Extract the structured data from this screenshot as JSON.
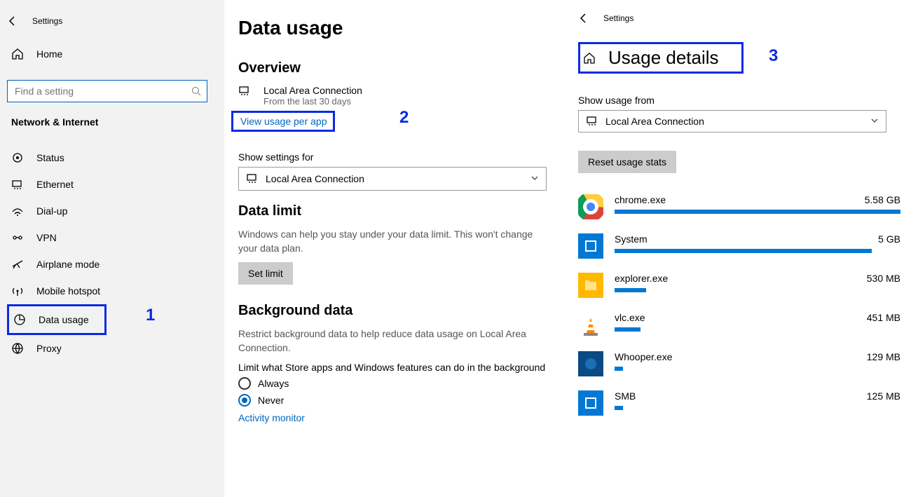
{
  "sidebar": {
    "topbar_label": "Settings",
    "home": "Home",
    "search_placeholder": "Find a setting",
    "section": "Network & Internet",
    "items": [
      {
        "label": "Status"
      },
      {
        "label": "Ethernet"
      },
      {
        "label": "Dial-up"
      },
      {
        "label": "VPN"
      },
      {
        "label": "Airplane mode"
      },
      {
        "label": "Mobile hotspot"
      },
      {
        "label": "Data usage"
      },
      {
        "label": "Proxy"
      }
    ]
  },
  "middle": {
    "title": "Data usage",
    "overview_hdr": "Overview",
    "conn_name": "Local Area Connection",
    "conn_sub": "From the last 30 days",
    "view_link": "View usage per app",
    "show_settings_lbl": "Show settings for",
    "show_settings_sel": "Local Area Connection",
    "data_limit_hdr": "Data limit",
    "data_limit_txt": "Windows can help you stay under your data limit. This won't change your data plan.",
    "set_limit_btn": "Set limit",
    "bg_hdr": "Background data",
    "bg_txt1": "Restrict background data to help reduce data usage on Local Area Connection.",
    "bg_txt2": "Limit what Store apps and Windows features can do in the background",
    "radio_always": "Always",
    "radio_never": "Never",
    "activity_link": "Activity monitor"
  },
  "right": {
    "topbar_label": "Settings",
    "title": "Usage details",
    "show_from_lbl": "Show usage from",
    "show_from_sel": "Local Area Connection",
    "reset_btn": "Reset usage stats",
    "apps": [
      {
        "name": "chrome.exe",
        "val": "5.58 GB",
        "pct": 100,
        "color": "chrome"
      },
      {
        "name": "System",
        "val": "5 GB",
        "pct": 90,
        "color": "blue"
      },
      {
        "name": "explorer.exe",
        "val": "530 MB",
        "pct": 11,
        "color": "yellow"
      },
      {
        "name": "vlc.exe",
        "val": "451 MB",
        "pct": 9,
        "color": "vlc"
      },
      {
        "name": "Whooper.exe",
        "val": "129 MB",
        "pct": 3,
        "color": "dark"
      },
      {
        "name": "SMB",
        "val": "125 MB",
        "pct": 3,
        "color": "blue"
      }
    ]
  },
  "annotations": {
    "a1": "1",
    "a2": "2",
    "a3": "3"
  }
}
